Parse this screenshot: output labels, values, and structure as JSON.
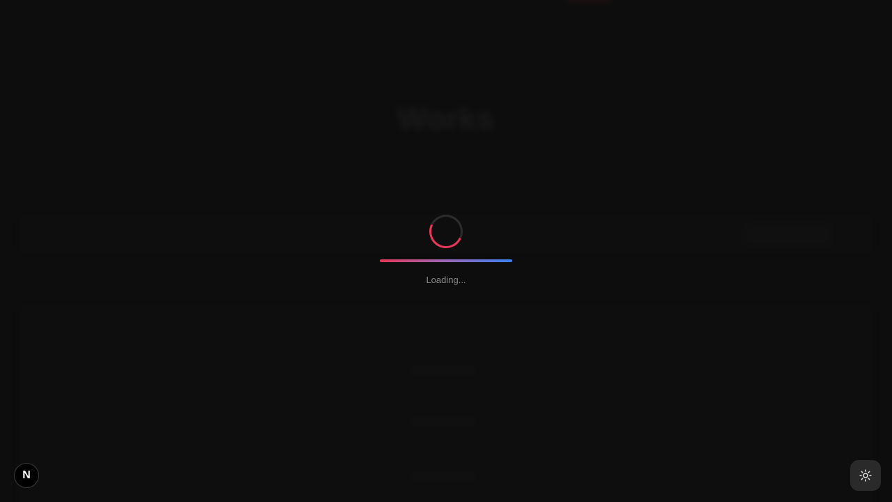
{
  "background_app": {
    "title": "Works",
    "subtitle": "",
    "search_placeholder": "",
    "add_button_label": "",
    "count_text": "",
    "table": {
      "headers": [
        "",
        "",
        "",
        ""
      ],
      "rows": [
        {
          "title": "",
          "subtitle": "",
          "url": "",
          "action": ""
        },
        {
          "title": "",
          "subtitle": "",
          "url": "",
          "action": ""
        },
        {
          "title": "",
          "subtitle": "",
          "url": "",
          "action": ""
        }
      ]
    }
  },
  "loader": {
    "text": "Loading...",
    "progress": 1.0,
    "colors": {
      "spinner_accent": "#e8385a",
      "gradient_start": "#e8385a",
      "gradient_end": "#3b82f6"
    }
  },
  "next_badge": {
    "label": "N",
    "icon": "nextjs-logo-icon"
  },
  "theme_toggle": {
    "icon": "sun-icon"
  }
}
